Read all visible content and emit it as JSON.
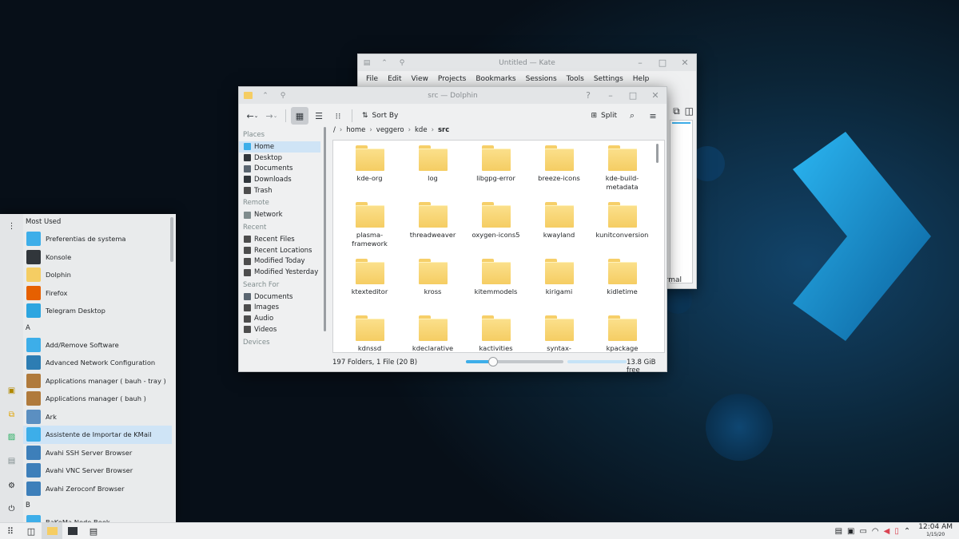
{
  "kate": {
    "title": "Untitled — Kate",
    "menu": [
      "File",
      "Edit",
      "View",
      "Projects",
      "Bookmarks",
      "Sessions",
      "Tools",
      "Settings",
      "Help"
    ],
    "status_text": "rmal"
  },
  "dolphin": {
    "title": "src — Dolphin",
    "sort_label": "Sort By",
    "split_label": "Split",
    "places_header": "Places",
    "places": [
      {
        "label": "Home",
        "icon": "home-icon",
        "active": true
      },
      {
        "label": "Desktop",
        "icon": "desktop-icon"
      },
      {
        "label": "Documents",
        "icon": "documents-icon"
      },
      {
        "label": "Downloads",
        "icon": "downloads-icon"
      },
      {
        "label": "Trash",
        "icon": "trash-icon"
      }
    ],
    "remote_header": "Remote",
    "remote": [
      {
        "label": "Network",
        "icon": "network-icon"
      }
    ],
    "recent_header": "Recent",
    "recent": [
      {
        "label": "Recent Files",
        "icon": "recent-files-icon"
      },
      {
        "label": "Recent Locations",
        "icon": "recent-locations-icon"
      },
      {
        "label": "Modified Today",
        "icon": "calendar-icon"
      },
      {
        "label": "Modified Yesterday",
        "icon": "calendar-icon"
      }
    ],
    "search_header": "Search For",
    "search": [
      {
        "label": "Documents",
        "icon": "documents-icon"
      },
      {
        "label": "Images",
        "icon": "images-icon"
      },
      {
        "label": "Audio",
        "icon": "audio-icon"
      },
      {
        "label": "Videos",
        "icon": "videos-icon"
      }
    ],
    "devices_header": "Devices",
    "breadcrumb": [
      "/",
      "home",
      "veggero",
      "kde",
      "src"
    ],
    "files": [
      "kde-org",
      "log",
      "libgpg-error",
      "breeze-icons",
      "kde-build-metadata",
      "plasma-framework",
      "threadweaver",
      "oxygen-icons5",
      "kwayland",
      "kunitconversion",
      "ktexteditor",
      "kross",
      "kitemmodels",
      "kirigami",
      "kidletime",
      "kdnssd",
      "kdeclarative",
      "kactivities",
      "syntax-highlighting",
      "kpackage"
    ],
    "status": "197 Folders, 1 File (20 B)",
    "zoom_fraction": 0.28,
    "free_space": "13.8 GiB free"
  },
  "kicker": {
    "most_used_header": "Most Used",
    "most_used": [
      {
        "label": "Preferentias de systema",
        "icon": "settings-icon",
        "color": "#3daee9"
      },
      {
        "label": "Konsole",
        "icon": "terminal-icon",
        "color": "#31363b"
      },
      {
        "label": "Dolphin",
        "icon": "folder-icon",
        "color": "#f5cd63"
      },
      {
        "label": "Firefox",
        "icon": "firefox-icon",
        "color": "#e66000"
      },
      {
        "label": "Telegram Desktop",
        "icon": "telegram-icon",
        "color": "#2ca5e0"
      }
    ],
    "a_header": "A",
    "a_apps": [
      {
        "label": "Add/Remove Software",
        "icon": "software-icon",
        "color": "#3daee9"
      },
      {
        "label": "Advanced Network Configuration",
        "icon": "network-icon",
        "color": "#2d7db3"
      },
      {
        "label": "Applications manager ( bauh - tray )",
        "icon": "bauh-icon",
        "color": "#b07a3c"
      },
      {
        "label": "Applications manager ( bauh )",
        "icon": "bauh-icon",
        "color": "#b07a3c"
      },
      {
        "label": "Ark",
        "icon": "ark-icon",
        "color": "#5b8fc1"
      },
      {
        "label": "Assistente de Importar de KMail",
        "icon": "kmail-import-icon",
        "color": "#3daee9",
        "highlight": true
      },
      {
        "label": "Avahi SSH Server Browser",
        "icon": "avahi-icon",
        "color": "#3d7fba"
      },
      {
        "label": "Avahi VNC Server Browser",
        "icon": "avahi-icon",
        "color": "#3d7fba"
      },
      {
        "label": "Avahi Zeroconf Browser",
        "icon": "avahi-icon",
        "color": "#3d7fba"
      }
    ],
    "b_header": "B",
    "b_apps": [
      {
        "label": "BaKoMa Node Book",
        "icon": "app-icon",
        "color": "#3daee9"
      }
    ]
  },
  "panel": {
    "time": "12:04 AM",
    "date": "1/15/20"
  }
}
